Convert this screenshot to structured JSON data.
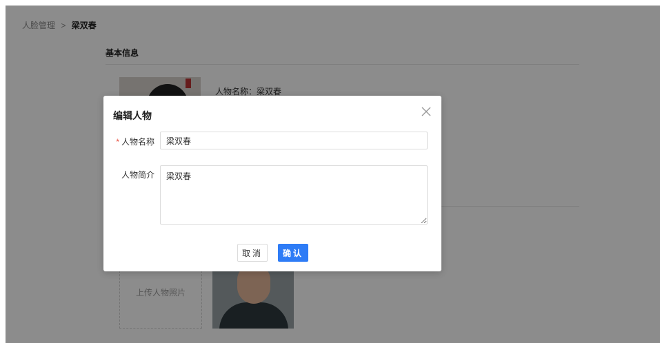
{
  "breadcrumb": {
    "parent": "人脸管理",
    "separator": ">",
    "current": "梁双春"
  },
  "basic_info": {
    "section_title": "基本信息",
    "name_line": "人物名称：梁双春"
  },
  "photos": {
    "upload_label": "上传人物照片"
  },
  "modal": {
    "title": "编辑人物",
    "name_field": {
      "required_mark": "*",
      "label": "人物名称",
      "value": "梁双春"
    },
    "intro_field": {
      "label": "人物简介",
      "value": "梁双春"
    },
    "cancel_label": "取消",
    "confirm_label": "确认"
  },
  "colors": {
    "primary": "#2e7cf6",
    "required": "#e74c3c",
    "overlay": "rgba(0,0,0,0.45)"
  },
  "icons": {
    "close": "close-icon"
  }
}
